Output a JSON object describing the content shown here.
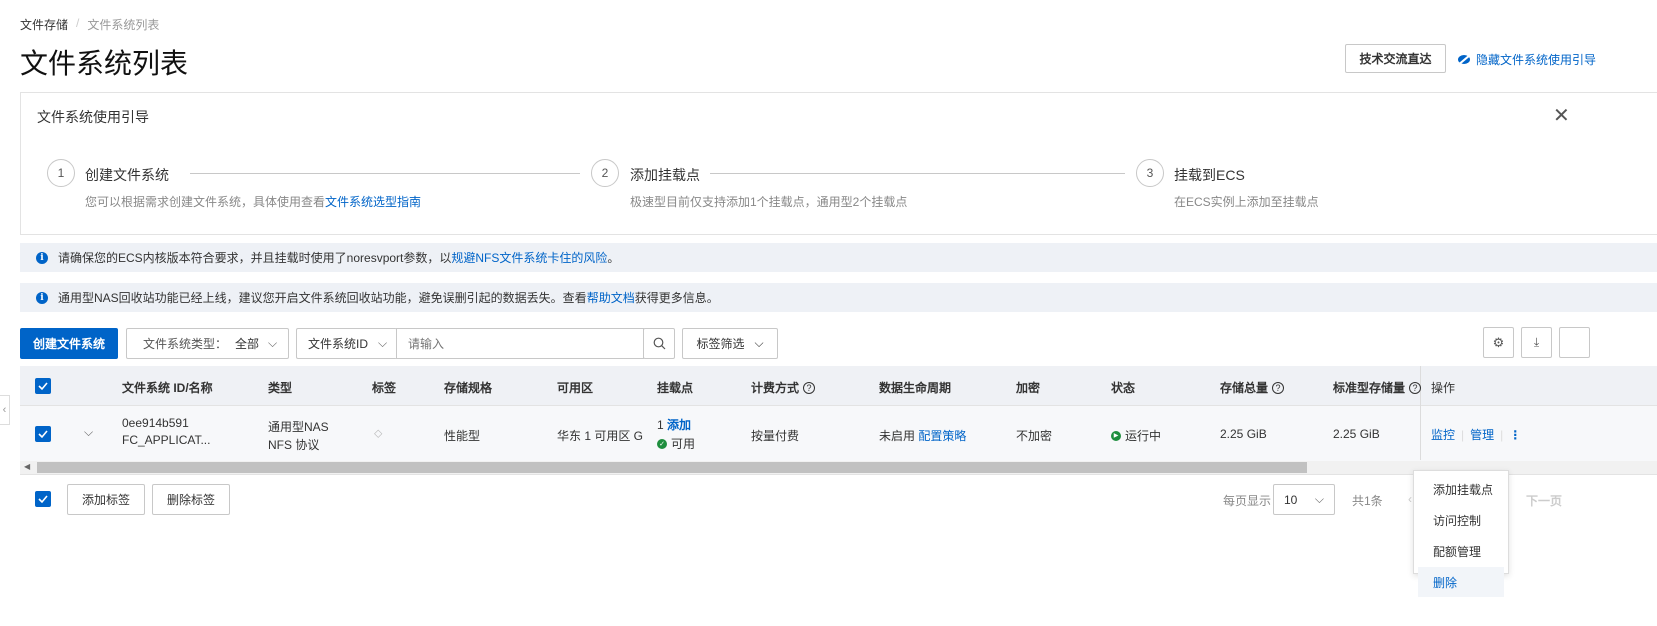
{
  "breadcrumb": [
    "文件存储",
    "/",
    "文件系统列表"
  ],
  "page_title": "文件系统列表",
  "header": {
    "tech_button": "技术交流直达",
    "hide_guide_link": "隐藏文件系统使用引导"
  },
  "guide": {
    "title": "文件系统使用引导",
    "steps": [
      {
        "num": "1",
        "label": "创建文件系统",
        "desc": "您可以根据需求创建文件系统，具体使用查看",
        "desc_link": "文件系统选型指南"
      },
      {
        "num": "2",
        "label": "添加挂载点",
        "desc": "极速型目前仅支持添加1个挂载点，通用型2个挂载点"
      },
      {
        "num": "3",
        "label": "挂载到ECS",
        "desc": "在ECS实例上添加至挂载点"
      }
    ]
  },
  "notices": [
    {
      "text": "请确保您的ECS内核版本符合要求，并且挂载时使用了noresvport参数，以",
      "link": "规避NFS文件系统卡住的风险",
      "suffix": "。"
    },
    {
      "text": "通用型NAS回收站功能已经上线，建议您开启文件系统回收站功能，避免误删引起的数据丢失。查看",
      "link": "帮助文档",
      "suffix": "获得更多信息。"
    }
  ],
  "toolbar": {
    "create_button": "创建文件系统",
    "type_filter_label": "文件系统类型：",
    "type_filter_value": "全部",
    "search_field": "文件系统ID",
    "search_placeholder": "请输入",
    "tag_filter": "标签筛选"
  },
  "table": {
    "columns": [
      "文件系统 ID/名称",
      "类型",
      "标签",
      "存储规格",
      "可用区",
      "挂载点",
      "计费方式",
      "数据生命周期",
      "加密",
      "状态",
      "存储总量",
      "标准型存储量",
      "操作"
    ],
    "rows": [
      {
        "id": "0ee914b591",
        "name": "FC_APPLICAT...",
        "type": "通用型NAS",
        "protocol": "NFS 协议",
        "spec": "性能型",
        "zone": "华东 1 可用区 G",
        "mount_count": "1",
        "mount_add": "添加",
        "mount_status": "可用",
        "billing": "按量付费",
        "lifecycle": "未启用",
        "lifecycle_link": "配置策略",
        "encrypt": "不加密",
        "status": "运行中",
        "total": "2.25 GiB",
        "standard": "2.25 GiB",
        "actions": [
          "监控",
          "管理"
        ]
      }
    ]
  },
  "dropdown_menu": [
    "添加挂载点",
    "访问控制",
    "配额管理",
    "删除"
  ],
  "footer": {
    "add_tag": "添加标签",
    "remove_tag": "删除标签",
    "page_size_label": "每页显示",
    "page_size": "10",
    "total": "共1条",
    "next": "下一页"
  },
  "colors": {
    "primary": "#0064c8",
    "success": "#1e8e3e",
    "notice_bg": "#eef1f6",
    "header_bg": "#eff1f5"
  }
}
